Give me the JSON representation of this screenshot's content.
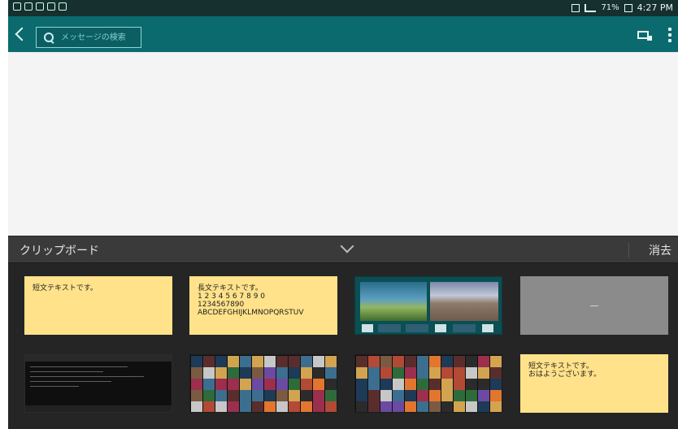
{
  "status_bar": {
    "left_icons": [
      "usb-icon",
      "wifi-icon",
      "image-icon",
      "picture-icon",
      "cloud-icon"
    ],
    "right_text": "71%",
    "time": "4:27 PM",
    "right_icons": [
      "nfc-icon",
      "signal-icon",
      "battery-icon"
    ]
  },
  "action_bar": {
    "search_placeholder": "メッセージの検索"
  },
  "clipboard": {
    "title": "クリップボード",
    "clear_label": "消去",
    "items": [
      {
        "type": "text",
        "text": "短文テキストです。"
      },
      {
        "type": "text",
        "text": "長文テキストです。\n1 2 3 4 5 6 7 8 9 0\n1234567890\nABCDEFGHIJKLMNOPQRSTUV"
      },
      {
        "type": "image"
      },
      {
        "type": "image"
      },
      {
        "type": "image"
      },
      {
        "type": "image"
      },
      {
        "type": "image"
      },
      {
        "type": "text",
        "text": "短文テキストです。\nおはようございます。"
      }
    ]
  },
  "colors": {
    "status_bar": "#16302f",
    "action_bar": "#0b6a6e",
    "message_area": "#f4f4f4",
    "clipboard_header": "#3a3a3a",
    "clipboard_bg": "#252525",
    "note": "#ffe28a"
  }
}
